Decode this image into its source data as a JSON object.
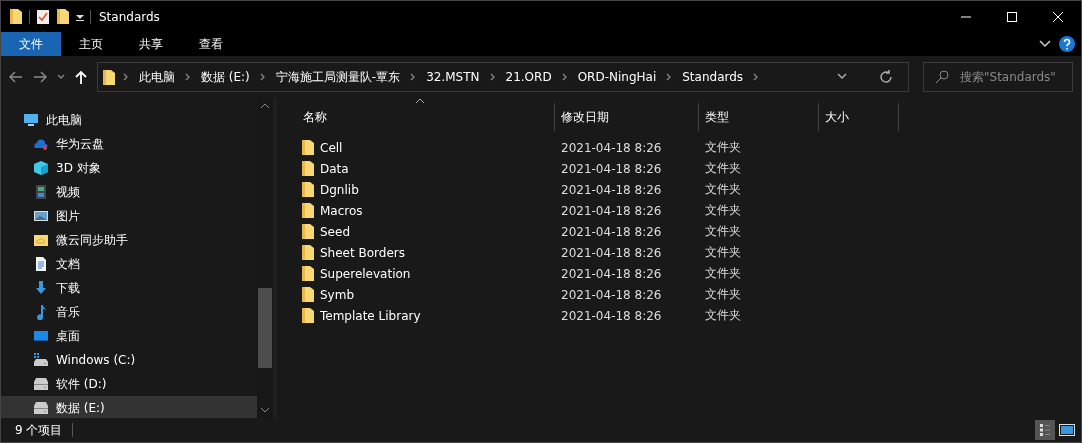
{
  "window": {
    "title": "Standards"
  },
  "ribbon_tabs": [
    {
      "label": "文件",
      "selected": true
    },
    {
      "label": "主页",
      "selected": false
    },
    {
      "label": "共享",
      "selected": false
    },
    {
      "label": "查看",
      "selected": false
    }
  ],
  "breadcrumbs": [
    "此电脑",
    "数据 (E:)",
    "宁海施工局测量队-覃东",
    "32.MSTN",
    "21.ORD",
    "ORD-NingHai",
    "Standards"
  ],
  "search": {
    "placeholder": "搜索\"Standards\""
  },
  "nav_tree": [
    {
      "label": "此电脑",
      "kind": "pc",
      "selected": false,
      "children": [
        {
          "label": "华为云盘",
          "kind": "cloud",
          "selected": false
        },
        {
          "label": "3D 对象",
          "kind": "cube",
          "selected": false
        },
        {
          "label": "视频",
          "kind": "video",
          "selected": false
        },
        {
          "label": "图片",
          "kind": "pictures",
          "selected": false
        },
        {
          "label": "微云同步助手",
          "kind": "syncfolder",
          "selected": false
        },
        {
          "label": "文档",
          "kind": "document",
          "selected": false
        },
        {
          "label": "下载",
          "kind": "download",
          "selected": false
        },
        {
          "label": "音乐",
          "kind": "music",
          "selected": false
        },
        {
          "label": "桌面",
          "kind": "desktop",
          "selected": false
        },
        {
          "label": "Windows (C:)",
          "kind": "sysdrive",
          "selected": false
        },
        {
          "label": "软件 (D:)",
          "kind": "drive",
          "selected": false
        },
        {
          "label": "数据 (E:)",
          "kind": "drive",
          "selected": true
        }
      ]
    }
  ],
  "table": {
    "columns": [
      "名称",
      "修改日期",
      "类型",
      "大小"
    ],
    "rows": [
      {
        "name": "Cell",
        "modified": "2021-04-18 8:26",
        "type": "文件夹"
      },
      {
        "name": "Data",
        "modified": "2021-04-18 8:26",
        "type": "文件夹"
      },
      {
        "name": "Dgnlib",
        "modified": "2021-04-18 8:26",
        "type": "文件夹"
      },
      {
        "name": "Macros",
        "modified": "2021-04-18 8:26",
        "type": "文件夹"
      },
      {
        "name": "Seed",
        "modified": "2021-04-18 8:26",
        "type": "文件夹"
      },
      {
        "name": "Sheet Borders",
        "modified": "2021-04-18 8:26",
        "type": "文件夹"
      },
      {
        "name": "Superelevation",
        "modified": "2021-04-18 8:26",
        "type": "文件夹"
      },
      {
        "name": "Symb",
        "modified": "2021-04-18 8:26",
        "type": "文件夹"
      },
      {
        "name": "Template Library",
        "modified": "2021-04-18 8:26",
        "type": "文件夹"
      }
    ]
  },
  "status_bar": {
    "item_count": "9 个项目"
  },
  "view_buttons": [
    {
      "kind": "details",
      "selected": true
    },
    {
      "kind": "tiles",
      "selected": false
    }
  ]
}
